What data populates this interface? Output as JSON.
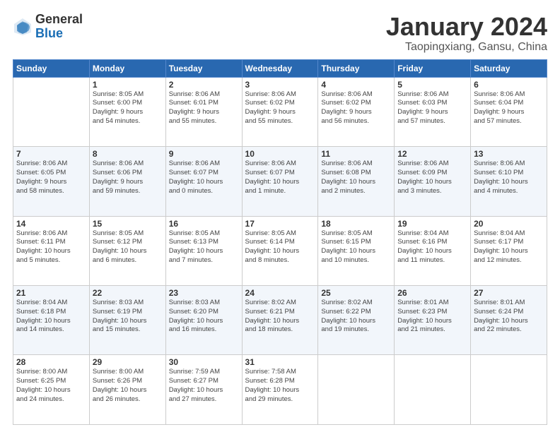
{
  "header": {
    "logo_general": "General",
    "logo_blue": "Blue",
    "month_title": "January 2024",
    "location": "Taopingxiang, Gansu, China"
  },
  "weekdays": [
    "Sunday",
    "Monday",
    "Tuesday",
    "Wednesday",
    "Thursday",
    "Friday",
    "Saturday"
  ],
  "weeks": [
    [
      {
        "day": "",
        "info": ""
      },
      {
        "day": "1",
        "info": "Sunrise: 8:05 AM\nSunset: 6:00 PM\nDaylight: 9 hours\nand 54 minutes."
      },
      {
        "day": "2",
        "info": "Sunrise: 8:06 AM\nSunset: 6:01 PM\nDaylight: 9 hours\nand 55 minutes."
      },
      {
        "day": "3",
        "info": "Sunrise: 8:06 AM\nSunset: 6:02 PM\nDaylight: 9 hours\nand 55 minutes."
      },
      {
        "day": "4",
        "info": "Sunrise: 8:06 AM\nSunset: 6:02 PM\nDaylight: 9 hours\nand 56 minutes."
      },
      {
        "day": "5",
        "info": "Sunrise: 8:06 AM\nSunset: 6:03 PM\nDaylight: 9 hours\nand 57 minutes."
      },
      {
        "day": "6",
        "info": "Sunrise: 8:06 AM\nSunset: 6:04 PM\nDaylight: 9 hours\nand 57 minutes."
      }
    ],
    [
      {
        "day": "7",
        "info": "Sunrise: 8:06 AM\nSunset: 6:05 PM\nDaylight: 9 hours\nand 58 minutes."
      },
      {
        "day": "8",
        "info": "Sunrise: 8:06 AM\nSunset: 6:06 PM\nDaylight: 9 hours\nand 59 minutes."
      },
      {
        "day": "9",
        "info": "Sunrise: 8:06 AM\nSunset: 6:07 PM\nDaylight: 10 hours\nand 0 minutes."
      },
      {
        "day": "10",
        "info": "Sunrise: 8:06 AM\nSunset: 6:07 PM\nDaylight: 10 hours\nand 1 minute."
      },
      {
        "day": "11",
        "info": "Sunrise: 8:06 AM\nSunset: 6:08 PM\nDaylight: 10 hours\nand 2 minutes."
      },
      {
        "day": "12",
        "info": "Sunrise: 8:06 AM\nSunset: 6:09 PM\nDaylight: 10 hours\nand 3 minutes."
      },
      {
        "day": "13",
        "info": "Sunrise: 8:06 AM\nSunset: 6:10 PM\nDaylight: 10 hours\nand 4 minutes."
      }
    ],
    [
      {
        "day": "14",
        "info": "Sunrise: 8:06 AM\nSunset: 6:11 PM\nDaylight: 10 hours\nand 5 minutes."
      },
      {
        "day": "15",
        "info": "Sunrise: 8:05 AM\nSunset: 6:12 PM\nDaylight: 10 hours\nand 6 minutes."
      },
      {
        "day": "16",
        "info": "Sunrise: 8:05 AM\nSunset: 6:13 PM\nDaylight: 10 hours\nand 7 minutes."
      },
      {
        "day": "17",
        "info": "Sunrise: 8:05 AM\nSunset: 6:14 PM\nDaylight: 10 hours\nand 8 minutes."
      },
      {
        "day": "18",
        "info": "Sunrise: 8:05 AM\nSunset: 6:15 PM\nDaylight: 10 hours\nand 10 minutes."
      },
      {
        "day": "19",
        "info": "Sunrise: 8:04 AM\nSunset: 6:16 PM\nDaylight: 10 hours\nand 11 minutes."
      },
      {
        "day": "20",
        "info": "Sunrise: 8:04 AM\nSunset: 6:17 PM\nDaylight: 10 hours\nand 12 minutes."
      }
    ],
    [
      {
        "day": "21",
        "info": "Sunrise: 8:04 AM\nSunset: 6:18 PM\nDaylight: 10 hours\nand 14 minutes."
      },
      {
        "day": "22",
        "info": "Sunrise: 8:03 AM\nSunset: 6:19 PM\nDaylight: 10 hours\nand 15 minutes."
      },
      {
        "day": "23",
        "info": "Sunrise: 8:03 AM\nSunset: 6:20 PM\nDaylight: 10 hours\nand 16 minutes."
      },
      {
        "day": "24",
        "info": "Sunrise: 8:02 AM\nSunset: 6:21 PM\nDaylight: 10 hours\nand 18 minutes."
      },
      {
        "day": "25",
        "info": "Sunrise: 8:02 AM\nSunset: 6:22 PM\nDaylight: 10 hours\nand 19 minutes."
      },
      {
        "day": "26",
        "info": "Sunrise: 8:01 AM\nSunset: 6:23 PM\nDaylight: 10 hours\nand 21 minutes."
      },
      {
        "day": "27",
        "info": "Sunrise: 8:01 AM\nSunset: 6:24 PM\nDaylight: 10 hours\nand 22 minutes."
      }
    ],
    [
      {
        "day": "28",
        "info": "Sunrise: 8:00 AM\nSunset: 6:25 PM\nDaylight: 10 hours\nand 24 minutes."
      },
      {
        "day": "29",
        "info": "Sunrise: 8:00 AM\nSunset: 6:26 PM\nDaylight: 10 hours\nand 26 minutes."
      },
      {
        "day": "30",
        "info": "Sunrise: 7:59 AM\nSunset: 6:27 PM\nDaylight: 10 hours\nand 27 minutes."
      },
      {
        "day": "31",
        "info": "Sunrise: 7:58 AM\nSunset: 6:28 PM\nDaylight: 10 hours\nand 29 minutes."
      },
      {
        "day": "",
        "info": ""
      },
      {
        "day": "",
        "info": ""
      },
      {
        "day": "",
        "info": ""
      }
    ]
  ]
}
